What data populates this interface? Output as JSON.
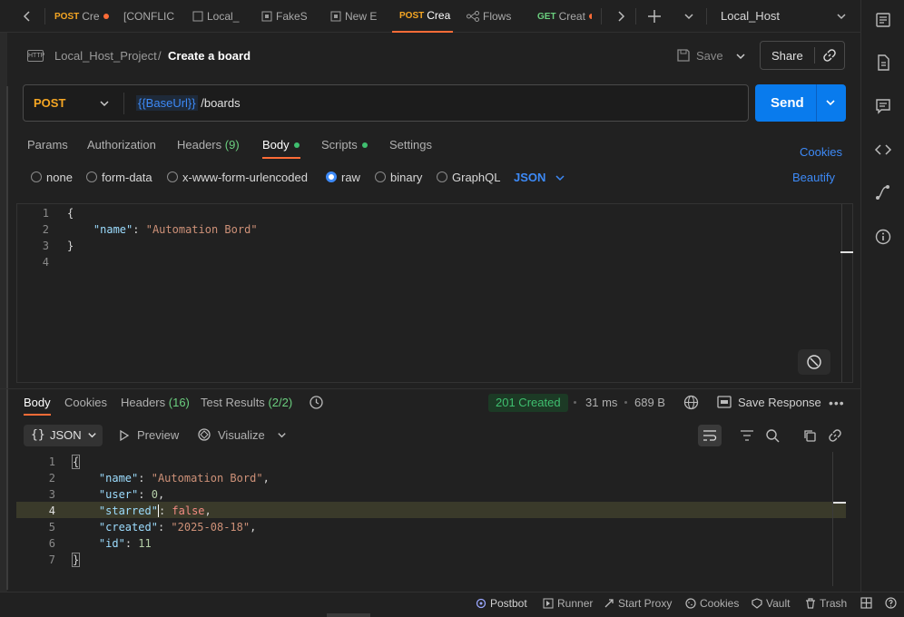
{
  "tabs": [
    {
      "method": "POST",
      "name": "Cre",
      "dot": true
    },
    {
      "method": "",
      "name": "[CONFLIC",
      "dot": true
    },
    {
      "method": "",
      "name": "Local_",
      "dot": false
    },
    {
      "method": "",
      "name": "FakeS",
      "dot": false
    },
    {
      "method": "",
      "name": "New E",
      "dot": false
    },
    {
      "method": "POST",
      "name": "Crea",
      "dot": false,
      "active": true
    },
    {
      "method": "",
      "name": "Flows",
      "dot": false
    },
    {
      "method": "GET",
      "name": "Creat",
      "dot": true
    }
  ],
  "environment": "Local_Host",
  "breadcrumb": {
    "project": "Local_Host_Project",
    "separator": "/",
    "request": "Create a board",
    "badge": "HTTP"
  },
  "toolbar": {
    "save": "Save",
    "share": "Share"
  },
  "request": {
    "method": "POST",
    "url_var": "{{BaseUrl}}",
    "url_path": " /boards",
    "send": "Send"
  },
  "req_tabs": {
    "params": "Params",
    "authorization": "Authorization",
    "headers": "Headers",
    "headers_count": "(9)",
    "body": "Body",
    "scripts": "Scripts",
    "settings": "Settings",
    "cookies": "Cookies"
  },
  "body_modes": {
    "none": "none",
    "form_data": "form-data",
    "urlencoded": "x-www-form-urlencoded",
    "raw": "raw",
    "binary": "binary",
    "graphql": "GraphQL",
    "format": "JSON",
    "beautify": "Beautify"
  },
  "request_body": {
    "line_numbers": [
      "1",
      "2",
      "3",
      "4"
    ],
    "lines": [
      "{",
      "    \"name\": \"Automation Bord\"",
      "}",
      ""
    ]
  },
  "response": {
    "tabs": {
      "body": "Body",
      "cookies": "Cookies",
      "headers": "Headers",
      "headers_count": "(16)",
      "tests": "Test Results",
      "tests_count": "(2/2)"
    },
    "status": "201 Created",
    "time": "31 ms",
    "size": "689 B",
    "save_response": "Save Response",
    "format": "JSON",
    "preview": "Preview",
    "visualize": "Visualize",
    "line_numbers": [
      "1",
      "2",
      "3",
      "4",
      "5",
      "6",
      "7"
    ],
    "json": {
      "name": "Automation Bord",
      "user": "0",
      "starred": "false",
      "created": "2025-08-18",
      "id": "11"
    }
  },
  "statusbar": {
    "postbot": "Postbot",
    "runner": "Runner",
    "proxy": "Start Proxy",
    "cookies": "Cookies",
    "vault": "Vault",
    "trash": "Trash"
  },
  "colors": {
    "accent": "#ff6c37",
    "send": "#097bed",
    "status_bg": "#1c3a25",
    "status_text": "#3fbf6f",
    "link": "#3d8af7"
  }
}
